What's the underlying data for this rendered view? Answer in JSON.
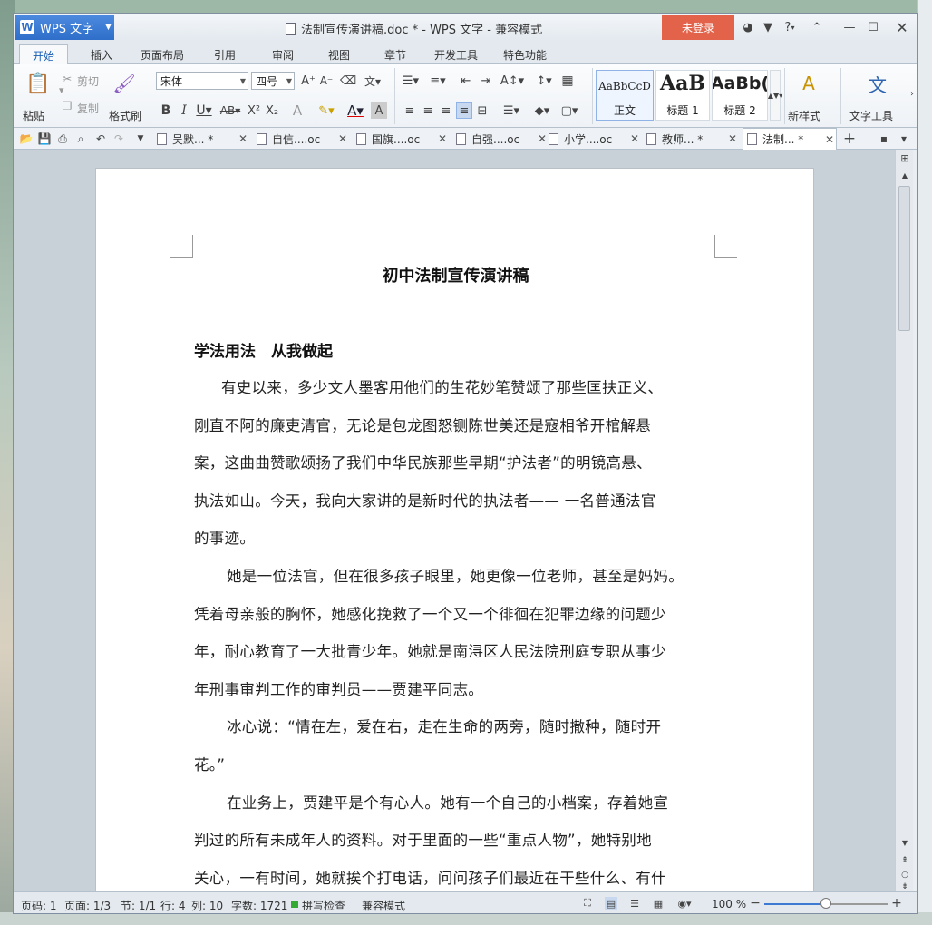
{
  "app": {
    "logo_letter": "W",
    "name": "WPS 文字",
    "window_title": "法制宣传演讲稿.doc * - WPS 文字 - 兼容模式",
    "login": "未登录",
    "help": "?"
  },
  "ribbon_tabs": [
    "开始",
    "插入",
    "页面布局",
    "引用",
    "审阅",
    "视图",
    "章节",
    "开发工具",
    "特色功能"
  ],
  "clipboard": {
    "paste": "粘贴",
    "cut": "剪切",
    "copy": "复制",
    "format_painter": "格式刷"
  },
  "font": {
    "name": "宋体",
    "size": "四号"
  },
  "styles": [
    {
      "preview": "AaBbCcD",
      "name": "正文"
    },
    {
      "preview": "AaB",
      "name": "标题 1"
    },
    {
      "preview": "AaBb(",
      "name": "标题 2"
    }
  ],
  "ribbon_right": {
    "new_style": "新样式",
    "text_tools": "文字工具"
  },
  "doc_tabs": [
    {
      "label": "吴默... *"
    },
    {
      "label": "自信....oc"
    },
    {
      "label": "国旗....oc"
    },
    {
      "label": "自强....oc"
    },
    {
      "label": "小学....oc"
    },
    {
      "label": "教师... *"
    },
    {
      "label": "法制... *"
    }
  ],
  "document": {
    "title": "初中法制宣传演讲稿",
    "subtitle": "学法用法　从我做起",
    "lines": [
      "有史以来，多少文人墨客用他们的生花妙笔赞颂了那些匡扶正义、",
      "刚直不阿的廉吏清官，无论是包龙图怒铡陈世美还是寇相爷开棺解悬",
      "案，这曲曲赞歌颂扬了我们中华民族那些早期“护法者”的明镜高悬、",
      "执法如山。今天，我向大家讲的是新时代的执法者—— 一名普通法官",
      "的事迹。",
      "她是一位法官，但在很多孩子眼里，她更像一位老师，甚至是妈妈。",
      "凭着母亲般的胸怀，她感化挽救了一个又一个徘徊在犯罪边缘的问题少",
      "年，耐心教育了一大批青少年。她就是南浔区人民法院刑庭专职从事少",
      "年刑事审判工作的审判员——贾建平同志。",
      "冰心说：“情在左，爱在右，走在生命的两旁，随时撒种，随时开",
      "花。”",
      "在业务上，贾建平是个有心人。她有一个自己的小档案，存着她宣",
      "判过的所有未成年人的资料。对于里面的一些“重点人物”，她特别地",
      "关心，一有时间，她就挨个打电话，问问孩子们最近在干些什么、有什"
    ]
  },
  "status": {
    "page_no": "页码: 1",
    "page": "页面: 1/3",
    "section": "节: 1/1",
    "row": "行: 4",
    "col": "列: 10",
    "words": "字数: 1721",
    "spell": "拼写检查",
    "compat": "兼容模式",
    "zoom": "100 %",
    "zoom_fraction": 0.5
  }
}
